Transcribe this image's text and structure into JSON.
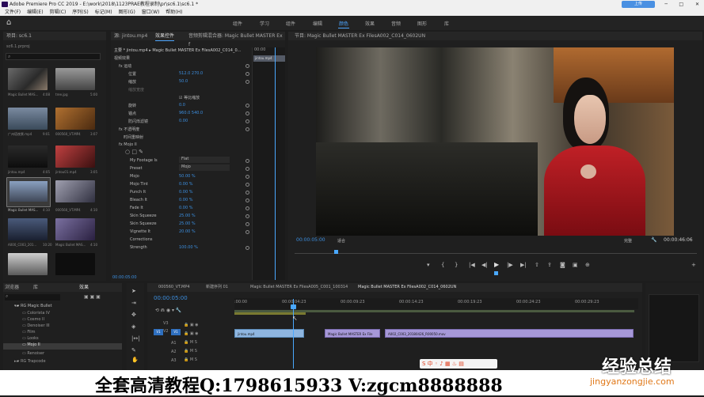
{
  "window": {
    "title": "Adobe Premiere Pro CC 2019 - E:\\work\\2018\\1123PRAE教程录制\\pr\\sc6.1\\sc6.1 *",
    "upload_label": "上传",
    "controls": [
      "─",
      "□",
      "✕"
    ]
  },
  "menu": [
    "文件(F)",
    "编辑(E)",
    "剪辑(C)",
    "序列(S)",
    "标记(M)",
    "图形(G)",
    "窗口(W)",
    "帮助(H)"
  ],
  "workspaces": [
    "组件",
    "学习",
    "组件",
    "编辑",
    "颜色",
    "效果",
    "音频",
    "图形",
    "库"
  ],
  "project": {
    "tab": "项目: sc6.1",
    "file": "sc6.1.prproj",
    "items": [
      {
        "name": "Magic Bullet MAS...",
        "dur": "4:08"
      },
      {
        "name": "tree.jpg",
        "dur": "5:00"
      },
      {
        "name": "广州塔夜景.mp4",
        "dur": "9:01"
      },
      {
        "name": "000560_VT.MP4",
        "dur": "3:07"
      },
      {
        "name": "jintou.mp4",
        "dur": "4:05"
      },
      {
        "name": "jintou01.mp4",
        "dur": "3:05"
      },
      {
        "name": "Magic Bullet MAS...",
        "dur": "4:10"
      },
      {
        "name": "000560_VT.MP4",
        "dur": "4:10"
      },
      {
        "name": "A000_C003_201...",
        "dur": "10:20"
      },
      {
        "name": "Magic Bullet MAS...",
        "dur": "4:10"
      },
      {
        "name": "",
        "dur": ""
      },
      {
        "name": "",
        "dur": ""
      }
    ]
  },
  "effect_controls": {
    "tabs": [
      "源: jintou.mp4",
      "效果控件",
      "音频剪辑混合器: Magic Bullet MASTER Ex f"
    ],
    "clip": "主要 * jintou.mp4 ▸ Magic Bullet MASTER Ex FilesA002_C014_0...",
    "video_effects": "视频效果",
    "mini_time": "00:00",
    "mini_clip": "jintou.mp4",
    "props": [
      {
        "label": "fx  运动",
        "value": ""
      },
      {
        "label": "位置",
        "value": "512.0    270.0"
      },
      {
        "label": "缩放",
        "value": "50.0"
      },
      {
        "label": "缩放宽度",
        "value": "☑ 等比缩放"
      },
      {
        "label": "旋转",
        "value": "0.0"
      },
      {
        "label": "锚点",
        "value": "960.0    540.0"
      },
      {
        "label": "防闪烁滤镜",
        "value": "0.00"
      },
      {
        "label": "fx  不透明度",
        "value": ""
      },
      {
        "label": "时间重映射",
        "value": ""
      },
      {
        "label": "fx  Mojo II",
        "value": ""
      },
      {
        "label": "My Footage Is",
        "value": "Flat"
      },
      {
        "label": "Preset",
        "value": "Mojo"
      },
      {
        "label": "Mojo",
        "value": "50.00  %"
      },
      {
        "label": "Mojo Tint",
        "value": "0.00  %"
      },
      {
        "label": "Punch It",
        "value": "0.00  %"
      },
      {
        "label": "Bleach It",
        "value": "0.00  %"
      },
      {
        "label": "Fade It",
        "value": "0.00  %"
      },
      {
        "label": "Skin Squeeze",
        "value": "25.00  %"
      },
      {
        "label": "Skin Squeeze",
        "value": "25.00  %"
      },
      {
        "label": "Vignette It",
        "value": "20.00  %"
      },
      {
        "label": "Corrections",
        "value": ""
      },
      {
        "label": "Strength",
        "value": "100.00  %"
      }
    ],
    "time": "00:00:05:00"
  },
  "program": {
    "tab": "节目: Magic Bullet MASTER Ex FilesA002_C014_0602UN",
    "timecode": "00:00:05:00",
    "fit": "适合",
    "quality": "完整",
    "duration": "00:00:46:06"
  },
  "effects_panel": {
    "tabs": [
      "浏览器",
      "库",
      "效果"
    ],
    "folder": "RG Magic Bullet",
    "items": [
      "Colorista IV",
      "Cosmo II",
      "Denoiser III",
      "Film",
      "Looks",
      "Mojo II",
      "Renoiser",
      "RG Trapcode"
    ]
  },
  "timeline": {
    "tabs": [
      "000560_VT.MP4",
      "新建序列 01",
      "Magic Bullet MASTER Ex FilesA005_C001_100314",
      "Magic Bullet MASTER Ex FilesA002_C014_0602UN"
    ],
    "timecode": "00:00:05:00",
    "ruler": [
      ":00:00",
      "00:00:04:23",
      "00:00:09:23",
      "00:00:14:23",
      "00:00:19:23",
      "00:00:24:23",
      "00:00:29:23"
    ],
    "tracks": [
      "V3",
      "V2",
      "V1",
      "A1",
      "A2",
      "A3"
    ],
    "clips": [
      "jintou.mp4",
      "Magic Bullet MASTER Ex File",
      "A002_C003_20180426_R00050.mov"
    ]
  },
  "watermark": {
    "text": "全套高清教程Q:1798615933 V:zgcm8888888",
    "site_main": "经验总结",
    "site_sub": "jingyanzongjie.com"
  },
  "colors": {
    "accent": "#4ea6ff",
    "clip_blue": "#8fb6e0",
    "clip_purple": "#a698d8",
    "playhead": "#4aa8ff"
  }
}
